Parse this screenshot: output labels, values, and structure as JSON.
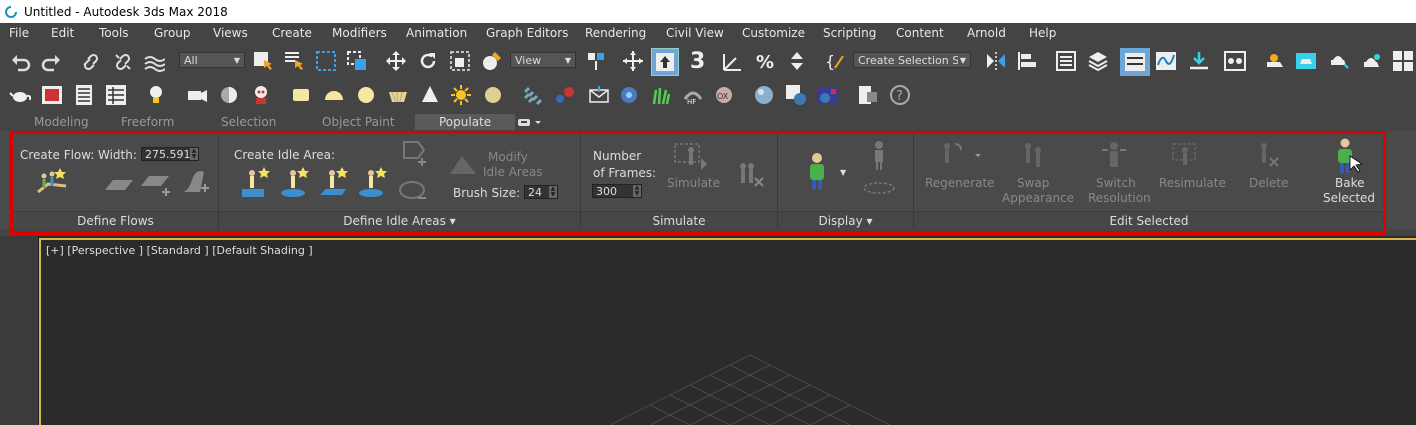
{
  "title": "Untitled - Autodesk 3ds Max 2018",
  "menu": [
    "File",
    "Edit",
    "Tools",
    "Group",
    "Views",
    "Create",
    "Modifiers",
    "Animation",
    "Graph Editors",
    "Rendering",
    "Civil View",
    "Customize",
    "Scripting",
    "Content",
    "Arnold",
    "Help"
  ],
  "toolbar": {
    "filter_value": "All",
    "view_value": "View",
    "snap_label": "3",
    "selection_set_value": "Create Selection Set"
  },
  "tabs": [
    "Modeling",
    "Freeform",
    "Selection",
    "Object Paint",
    "Populate"
  ],
  "active_tab": "Populate",
  "ribbon": {
    "define_flows": {
      "create_flow_label": "Create Flow:",
      "width_label": "Width:",
      "width_value": "275.591",
      "footer": "Define Flows"
    },
    "define_idle": {
      "create_idle_label": "Create Idle Area:",
      "modify_line1": "Modify",
      "modify_line2": "Idle Areas",
      "brush_label": "Brush Size:",
      "brush_value": "24",
      "footer": "Define Idle Areas ▾"
    },
    "simulate": {
      "frames_line1": "Number",
      "frames_line2": "of Frames:",
      "frames_value": "300",
      "simulate_label": "Simulate",
      "footer": "Simulate"
    },
    "display": {
      "footer": "Display ▾"
    },
    "edit_selected": {
      "regenerate": "Regenerate",
      "swap1": "Swap",
      "swap2": "Appearance",
      "switch1": "Switch",
      "switch2": "Resolution",
      "resimulate": "Resimulate",
      "delete": "Delete",
      "bake1": "Bake",
      "bake2": "Selected",
      "footer": "Edit Selected"
    }
  },
  "viewport_label": "[+] [Perspective ] [Standard ] [Default Shading ]",
  "colors": {
    "highlight": "#e00000",
    "viewport_border": "#d6b84a",
    "accent_blue": "#3a8fd0"
  }
}
